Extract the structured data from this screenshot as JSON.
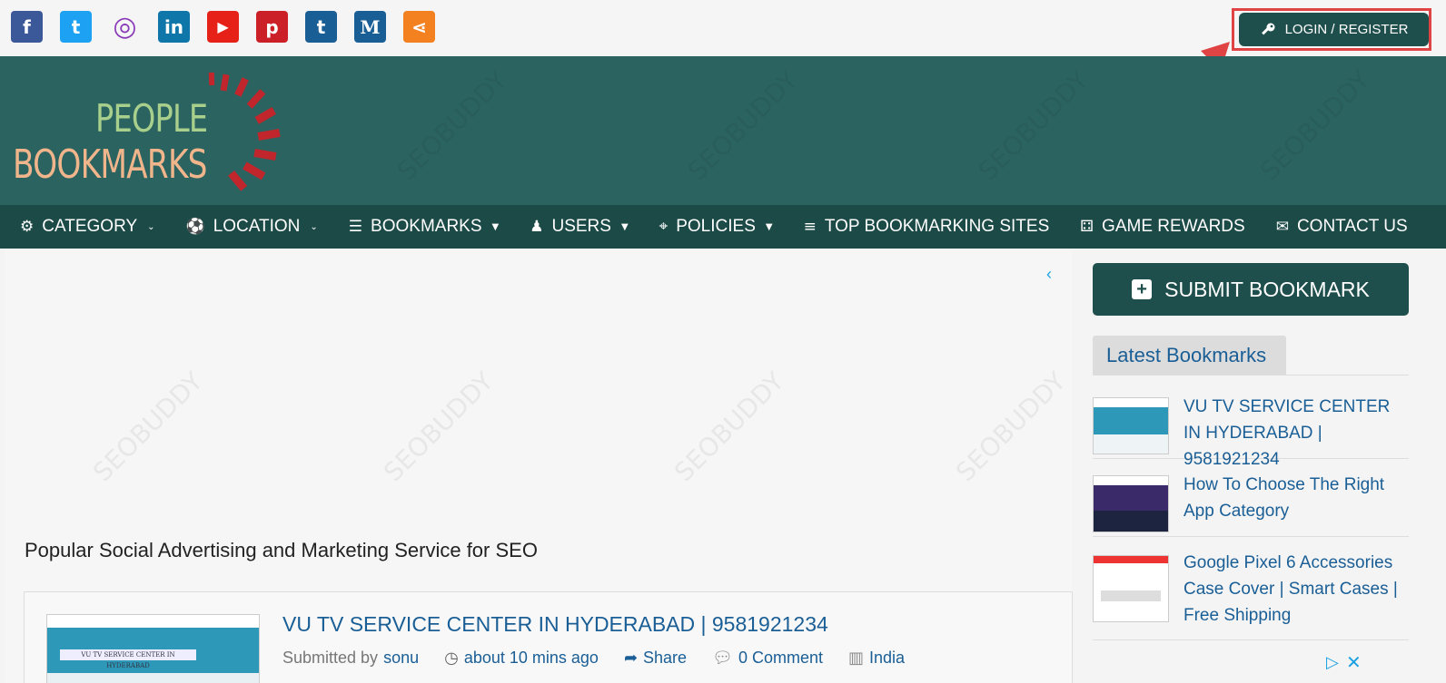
{
  "social": [
    {
      "name": "facebook-icon",
      "glyph": "f",
      "color": "#3b5998"
    },
    {
      "name": "twitter-icon",
      "glyph": "t",
      "color": "#1da1f2"
    },
    {
      "name": "instagram-icon",
      "glyph": "◎",
      "color": "#8a3ab9"
    },
    {
      "name": "linkedin-icon",
      "glyph": "in",
      "color": "#0e76a8"
    },
    {
      "name": "youtube-icon",
      "glyph": "▶",
      "color": "#e62117"
    },
    {
      "name": "pinterest-icon",
      "glyph": "p",
      "color": "#cb2027"
    },
    {
      "name": "tumblr-icon",
      "glyph": "t",
      "color": "#1a5e96"
    },
    {
      "name": "medium-icon",
      "glyph": "M",
      "color": "#1a5e96"
    },
    {
      "name": "share-icon",
      "glyph": "⋖",
      "color": "#f48120"
    }
  ],
  "header": {
    "login_label": "LOGIN / REGISTER",
    "logo_line1": "PEOPLE",
    "logo_line2": "BOOKMARKS"
  },
  "nav": [
    {
      "label": "CATEGORY",
      "icon": "⚙",
      "caret": "⌄"
    },
    {
      "label": "LOCATION",
      "icon": "⚽",
      "caret": "⌄"
    },
    {
      "label": "BOOKMARKS",
      "icon": "☰",
      "caret": "▼"
    },
    {
      "label": "USERS",
      "icon": "♟",
      "caret": "▼"
    },
    {
      "label": "POLICIES",
      "icon": "⌖",
      "caret": "▼"
    },
    {
      "label": "TOP BOOKMARKING SITES",
      "icon": "≡",
      "caret": ""
    },
    {
      "label": "GAME REWARDS",
      "icon": "⚃",
      "caret": ""
    },
    {
      "label": "CONTACT US",
      "icon": "✉",
      "caret": ""
    }
  ],
  "main": {
    "section_title": "Popular Social Advertising and Marketing Service for SEO",
    "card": {
      "title": "VU TV SERVICE CENTER IN HYDERABAD | 9581921234",
      "thumb_text": "VU TV SERVICE CENTER IN HYDERABAD",
      "submitted_prefix": "Submitted by",
      "user": "sonu",
      "time": "about 10 mins ago",
      "share": "Share",
      "comments": "0 Comment",
      "location": "India"
    }
  },
  "sidebar": {
    "submit_label": "SUBMIT BOOKMARK",
    "latest_title": "Latest Bookmarks",
    "latest": [
      "VU TV SERVICE CENTER IN HYDERABAD | 9581921234",
      "How To Choose The Right App Category",
      "Google Pixel 6 Accessories Case Cover | Smart Cases | Free Shipping"
    ]
  },
  "colors": {
    "brand": "#1f4f4c",
    "header_bg": "#2b6360",
    "nav_bg": "#1c4a47",
    "link": "#1a5e96",
    "highlight": "#e04343"
  }
}
